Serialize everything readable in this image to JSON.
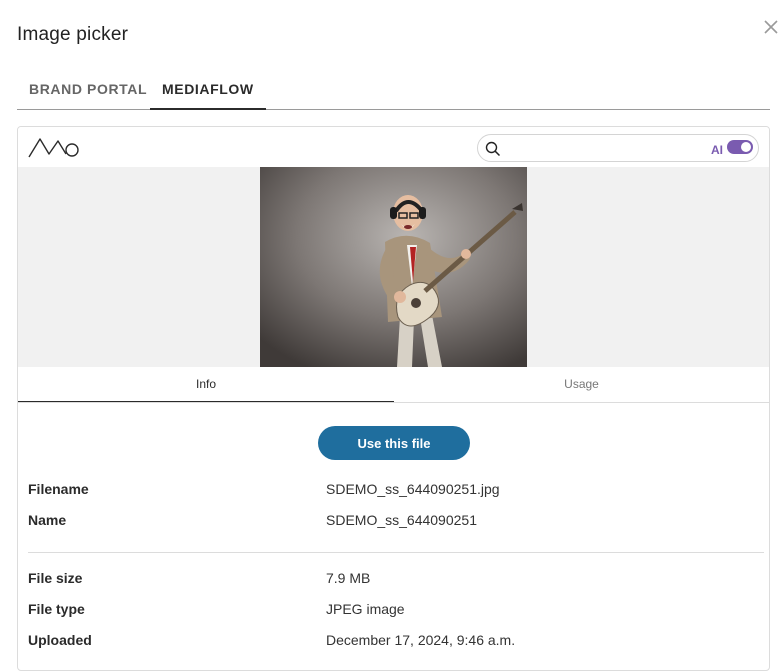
{
  "dialog": {
    "title": "Image picker",
    "close_icon": "close-icon"
  },
  "tabs": [
    {
      "label": "BRAND PORTAL",
      "active": false
    },
    {
      "label": "MEDIAFLOW",
      "active": true
    }
  ],
  "toolbar": {
    "logo_icon": "mediaflow-logo",
    "search": {
      "value": "",
      "placeholder": "",
      "icon": "search-icon"
    },
    "ai": {
      "label": "AI",
      "enabled": true,
      "color": "#7a5bb0"
    }
  },
  "preview": {
    "icon": "photo-man-playing-guitar"
  },
  "detail_tabs": [
    {
      "label": "Info",
      "active": true
    },
    {
      "label": "Usage",
      "active": false
    }
  ],
  "actions": {
    "use_file_label": "Use this file",
    "color": "#1f6e9e"
  },
  "info": {
    "filename": {
      "label": "Filename",
      "value": "SDEMO_ss_644090251.jpg"
    },
    "name": {
      "label": "Name",
      "value": "SDEMO_ss_644090251"
    },
    "file_size": {
      "label": "File size",
      "value": "7.9 MB"
    },
    "file_type": {
      "label": "File type",
      "value": "JPEG image"
    },
    "uploaded": {
      "label": "Uploaded",
      "value": "December 17, 2024, 9:46 a.m."
    }
  }
}
